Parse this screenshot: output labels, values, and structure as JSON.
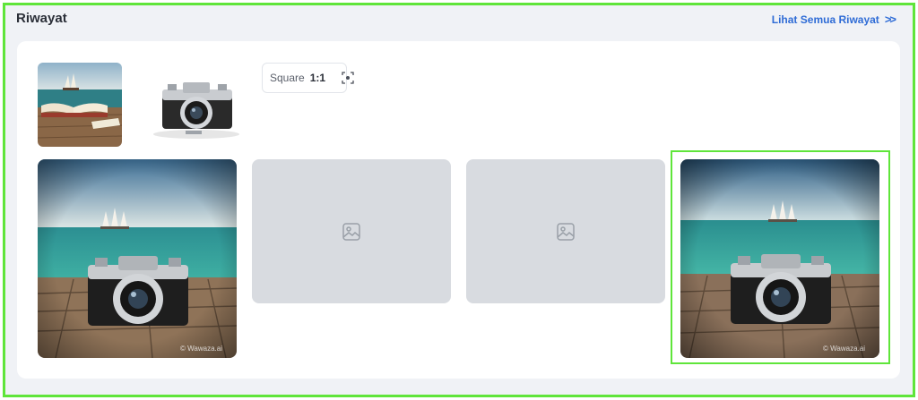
{
  "section": {
    "title": "Riwayat",
    "see_all_label": "Lihat Semua Riwayat",
    "see_all_chevron": ">>"
  },
  "prompt_bar": {
    "ratio_label": "Square",
    "ratio_value": "1:1"
  },
  "results": [
    {
      "state": "image",
      "watermark": "© Wawaza.ai"
    },
    {
      "state": "placeholder"
    },
    {
      "state": "placeholder"
    },
    {
      "state": "image",
      "watermark": "© Wawaza.ai",
      "selected": true
    }
  ],
  "colors": {
    "accent_link": "#2f6cd6",
    "highlight_border": "#5fe53a",
    "placeholder_bg": "#d8dbe0"
  }
}
